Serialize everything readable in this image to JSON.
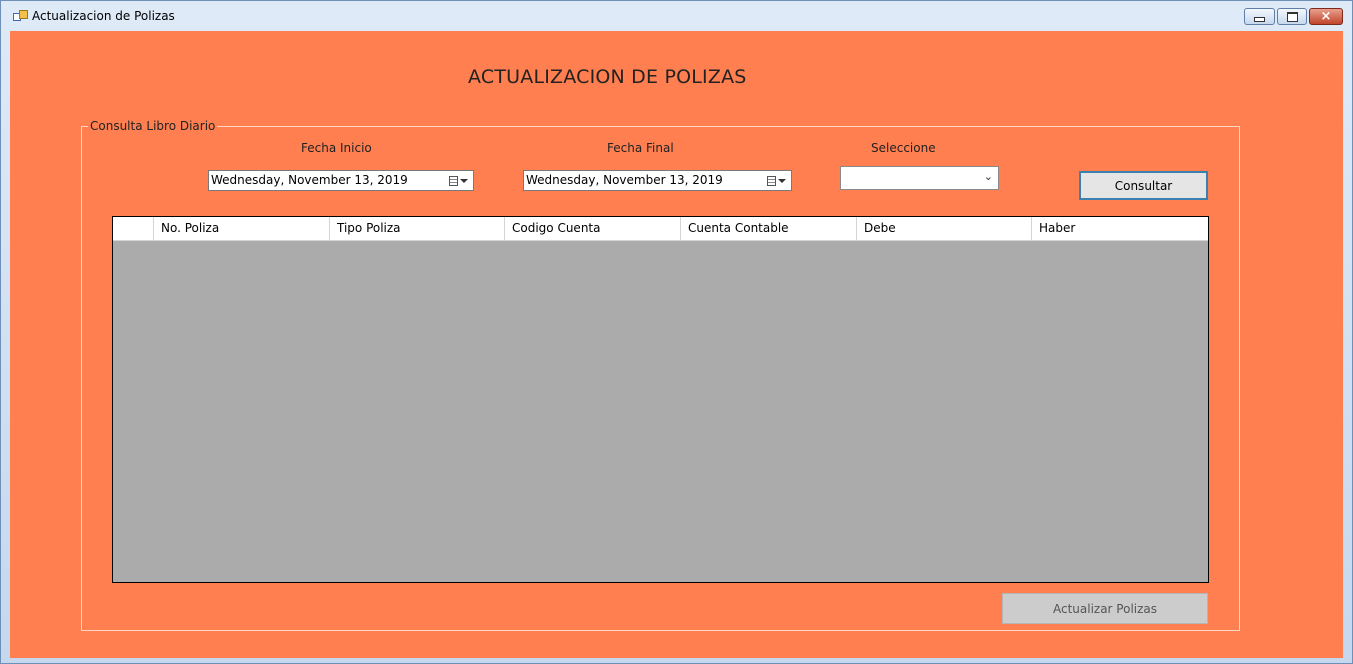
{
  "window": {
    "title": "Actualizacion de Polizas",
    "controls": {
      "minimize": "minimize",
      "maximize": "maximize",
      "close": "×"
    }
  },
  "form": {
    "heading": "ACTUALIZACION DE POLIZAS",
    "group_label": "Consulta Libro Diario",
    "fecha_inicio": {
      "label": "Fecha Inicio",
      "value": "Wednesday,   November   13, 2019"
    },
    "fecha_final": {
      "label": "Fecha Final",
      "value": "Wednesday,   November   13, 2019"
    },
    "seleccione": {
      "label": "Seleccione",
      "value": ""
    },
    "consultar_label": "Consultar",
    "actualizar_label": "Actualizar Polizas"
  },
  "grid": {
    "columns": [
      "",
      "No. Poliza",
      "Tipo Poliza",
      "Codigo Cuenta",
      "Cuenta Contable",
      "Debe",
      "Haber"
    ],
    "rows": []
  },
  "colors": {
    "form_background": "#ff7f50",
    "grid_background": "#ababab",
    "button_border_focus": "#3c7fb1"
  },
  "icons": [
    "app-icon",
    "calendar-icon",
    "dropdown-arrow-icon",
    "chevron-down-icon"
  ]
}
